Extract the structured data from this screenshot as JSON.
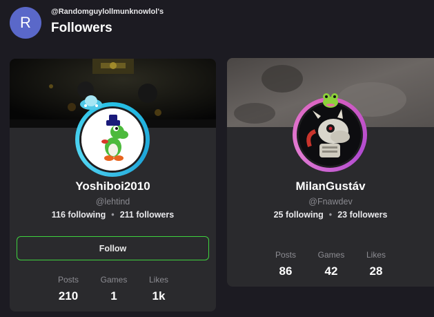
{
  "header": {
    "avatar_letter": "R",
    "handle": "@Randomguylollmunknowlol's",
    "title": "Followers"
  },
  "followers": [
    {
      "name": "Yoshiboi2010",
      "handle": "@lehtind",
      "following": "116 following",
      "followers": "211 followers",
      "follow_label": "Follow",
      "stats": [
        {
          "label": "Posts",
          "value": "210"
        },
        {
          "label": "Games",
          "value": "1"
        },
        {
          "label": "Likes",
          "value": "1k"
        }
      ],
      "ring_color": "#27c1e6"
    },
    {
      "name": "MilanGustáv",
      "handle": "@Fnawdev",
      "following": "25 following",
      "followers": "23 followers",
      "stats": [
        {
          "label": "Posts",
          "value": "86"
        },
        {
          "label": "Games",
          "value": "42"
        },
        {
          "label": "Likes",
          "value": "28"
        }
      ],
      "ring_color": "#d95fbf"
    }
  ],
  "colors": {
    "background": "#1c1b22",
    "card": "#2a2a2d",
    "follow_border": "#3fd33f",
    "avatar_letter_bg": "#5a68c9"
  }
}
